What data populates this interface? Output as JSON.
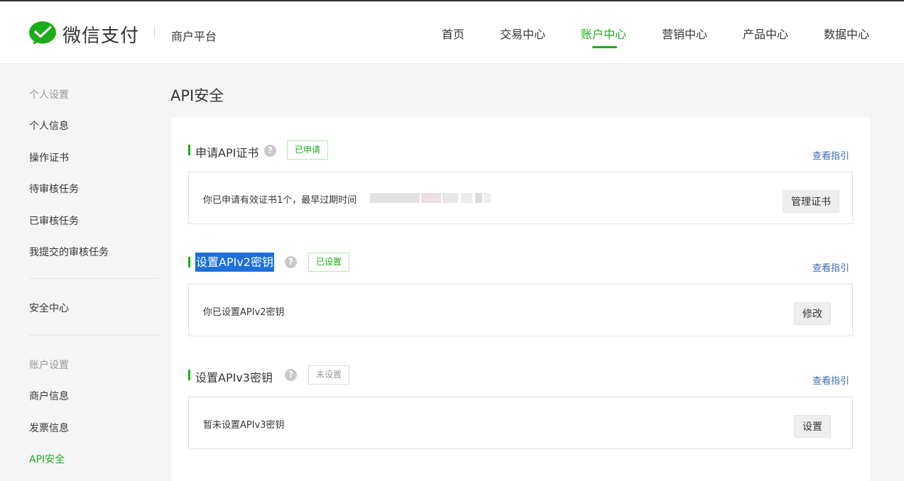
{
  "header": {
    "brand": "微信支付",
    "platform": "商户平台",
    "nav": [
      "首页",
      "交易中心",
      "账户中心",
      "营销中心",
      "产品中心",
      "数据中心"
    ],
    "active_nav": "账户中心",
    "accent": "#1aad19",
    "logo_icon": "wechat-pay-logo-icon"
  },
  "sidebar": {
    "group1": "个人设置",
    "items1": [
      "个人信息",
      "操作证书",
      "待审核任务",
      "已审核任务",
      "我提交的审核任务"
    ],
    "item_security": "安全中心",
    "group2": "账户设置",
    "items2": [
      "商户信息",
      "发票信息",
      "API安全"
    ],
    "active_item": "API安全"
  },
  "main": {
    "title": "API安全",
    "sections": [
      {
        "title": "申请API证书",
        "tag": "已申请",
        "guide": "查看指引",
        "text": "你已申请有效证书1个，最早过期时间",
        "button": "管理证书",
        "redacted": true
      },
      {
        "title": "设置APIv2密钥",
        "tag": "已设置",
        "guide": "查看指引",
        "text": "你已设置APIv2密钥",
        "button": "修改",
        "title_selected": true
      },
      {
        "title": "设置APIv3密钥",
        "tag": "未设置",
        "guide": "查看指引",
        "text": "暂未设置APIv3密钥",
        "button": "设置"
      }
    ]
  }
}
